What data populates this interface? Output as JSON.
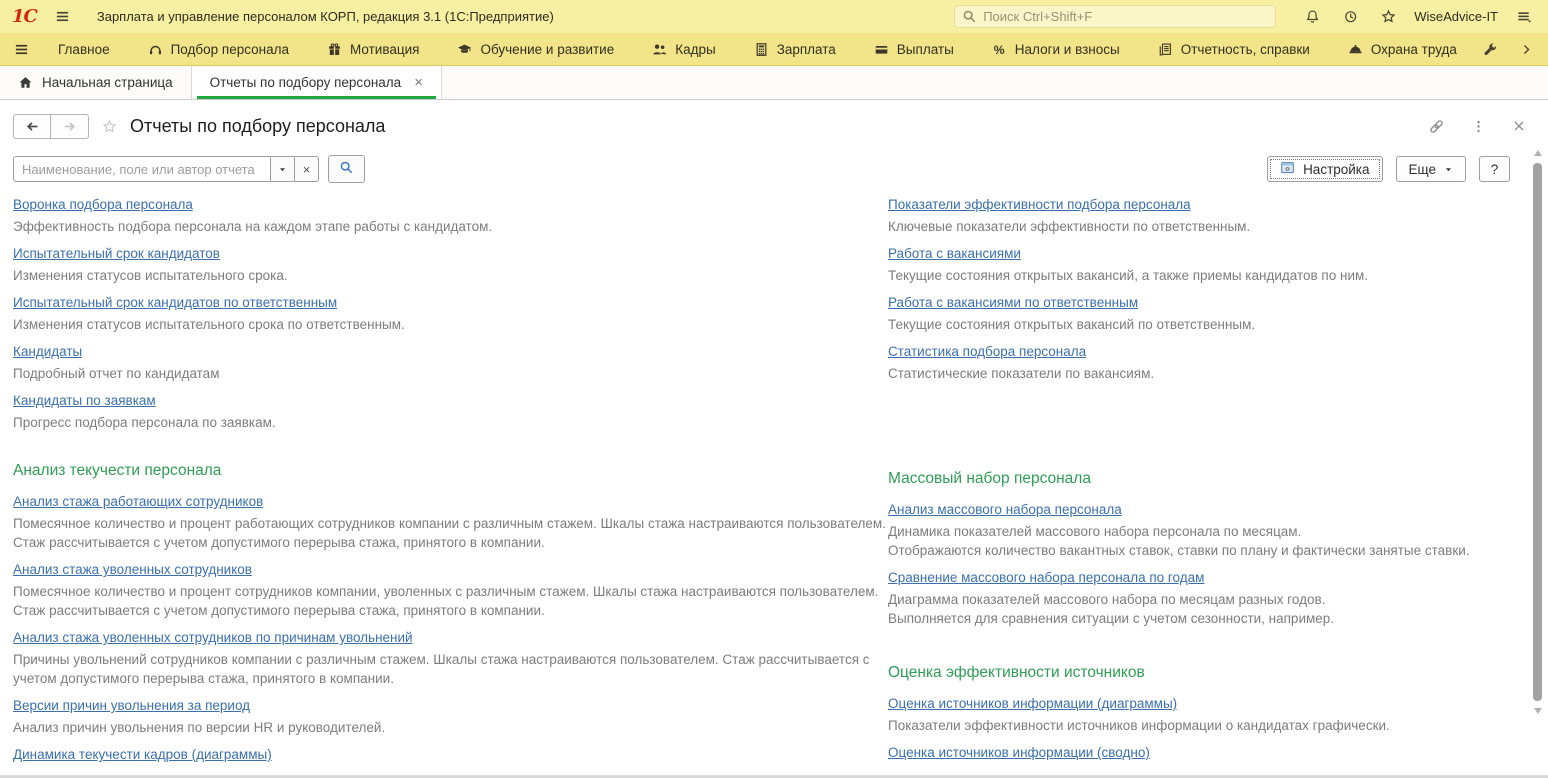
{
  "titlebar": {
    "app_title": "Зарплата и управление персоналом КОРП, редакция 3.1  (1С:Предприятие)",
    "search_placeholder": "Поиск Ctrl+Shift+F",
    "user": "WiseAdvice-IT",
    "logo": "1С"
  },
  "menubar": {
    "items": [
      {
        "label": "Главное",
        "icon": ""
      },
      {
        "label": "Подбор персонала",
        "icon": "headset"
      },
      {
        "label": "Мотивация",
        "icon": "gift"
      },
      {
        "label": "Обучение и развитие",
        "icon": "graduation-cap"
      },
      {
        "label": "Кадры",
        "icon": "people"
      },
      {
        "label": "Зарплата",
        "icon": "calculator"
      },
      {
        "label": "Выплаты",
        "icon": "card"
      },
      {
        "label": "Налоги и взносы",
        "icon": "percent"
      },
      {
        "label": "Отчетность, справки",
        "icon": "report"
      },
      {
        "label": "Охрана труда",
        "icon": "helmet"
      }
    ]
  },
  "tabs": [
    {
      "label": "Начальная страница",
      "icon": "home",
      "active": false,
      "closable": false
    },
    {
      "label": "Отчеты по подбору персонала",
      "icon": "",
      "active": true,
      "closable": true
    }
  ],
  "page": {
    "title": "Отчеты по подбору персонала",
    "search_placeholder": "Наименование, поле или автор отчета",
    "settings_label": "Настройка",
    "more_label": "Еще",
    "help_label": "?"
  },
  "colors": {
    "titlebar_bg": "#f7f0a2",
    "menubar_bg": "#f1e489",
    "link": "#3a70ae",
    "description_text": "#7d7d7d",
    "section_header": "#2f9d54",
    "active_tab_underline": "#22a73f"
  },
  "columns": {
    "left": [
      {
        "header": "",
        "items": [
          {
            "title": "Воронка подбора персонала",
            "desc": "Эффективность подбора персонала на каждом этапе работы с кандидатом."
          },
          {
            "title": "Испытательный срок кандидатов",
            "desc": "Изменения статусов испытательного срока."
          },
          {
            "title": "Испытательный срок кандидатов по ответственным",
            "desc": "Изменения статусов испытательного срока по ответственным."
          },
          {
            "title": "Кандидаты",
            "desc": "Подробный отчет по кандидатам"
          },
          {
            "title": "Кандидаты по заявкам",
            "desc": "Прогресс подбора персонала по заявкам."
          }
        ]
      },
      {
        "header": "Анализ текучести персонала",
        "items": [
          {
            "title": "Анализ стажа работающих сотрудников",
            "desc": "Помесячное количество и процент работающих сотрудников компании с различным стажем. Шкалы стажа настраиваются пользователем. Стаж рассчитывается с учетом допустимого перерыва стажа, принятого в компании."
          },
          {
            "title": "Анализ стажа уволенных сотрудников",
            "desc": "Помесячное количество и процент сотрудников компании, уволенных с различным стажем. Шкалы стажа настраиваются пользователем. Стаж рассчитывается с учетом допустимого перерыва стажа, принятого в компании."
          },
          {
            "title": "Анализ стажа уволенных сотрудников по причинам увольнений",
            "desc": "Причины увольнений сотрудников компании с различным стажем. Шкалы стажа настраиваются пользователем. Стаж рассчитывается с учетом допустимого перерыва стажа, принятого в компании."
          },
          {
            "title": "Версии причин увольнения за период",
            "desc": "Анализ причин увольнения по версии HR и руководителей."
          },
          {
            "title": "Динамика текучести кадров (диаграммы)",
            "desc": ""
          }
        ]
      }
    ],
    "right": [
      {
        "header": "",
        "items": [
          {
            "title": "Показатели эффективности подбора персонала",
            "desc": "Ключевые показатели эффективности по ответственным."
          },
          {
            "title": "Работа с вакансиями",
            "desc": "Текущие состояния открытых вакансий, а также приемы кандидатов по ним."
          },
          {
            "title": "Работа с вакансиями по ответственным",
            "desc": "Текущие состояния открытых вакансий по ответственным."
          },
          {
            "title": "Статистика подбора персонала",
            "desc": "Статистические показатели по вакансиям."
          }
        ]
      },
      {
        "header": "Массовый набор персонала",
        "items": [
          {
            "title": "Анализ массового набора персонала",
            "desc": "Динамика показателей массового набора персонала по месяцам.\nОтображаются количество вакантных ставок, ставки по плану и фактически занятые ставки."
          },
          {
            "title": "Сравнение массового набора персонала по годам",
            "desc": "Диаграмма показателей массового набора по месяцам разных годов.\nВыполняется для сравнения ситуации с учетом сезонности, например."
          }
        ]
      },
      {
        "header": "Оценка эффективности источников",
        "items": [
          {
            "title": "Оценка источников информации (диаграммы)",
            "desc": "Показатели эффективности источников информации о кандидатах графически."
          },
          {
            "title": "Оценка источников информации (сводно)",
            "desc": ""
          }
        ]
      }
    ]
  }
}
